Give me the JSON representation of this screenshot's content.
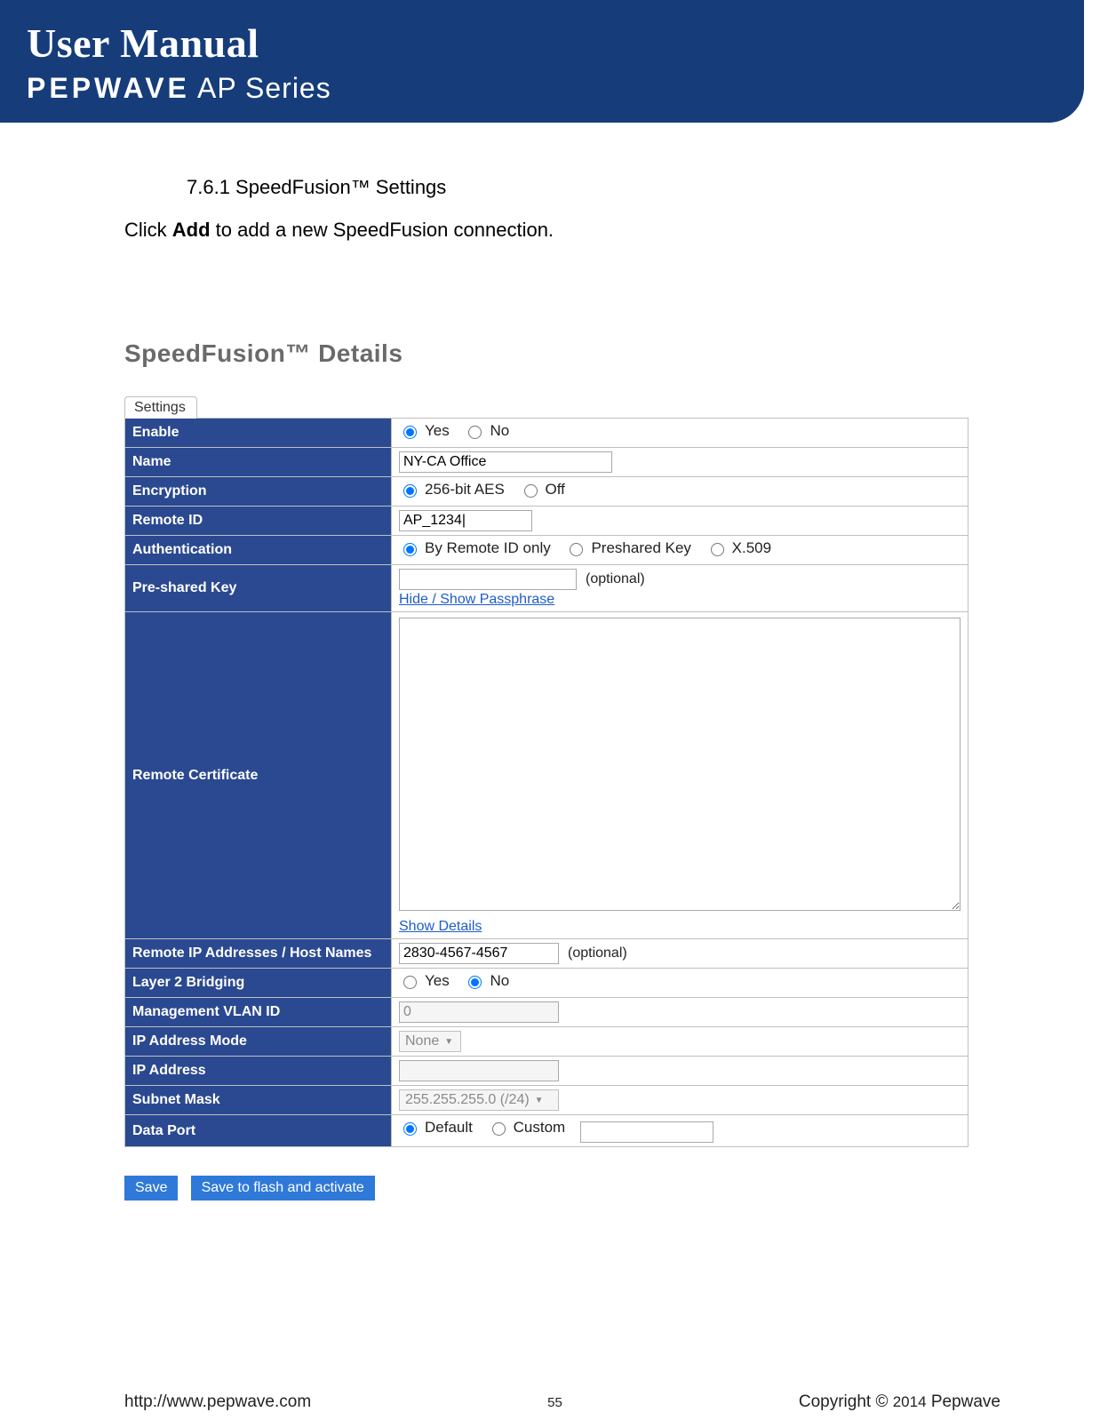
{
  "banner": {
    "title": "User Manual",
    "brand": "PEPWAVE",
    "series": " AP Series"
  },
  "section": {
    "heading": "7.6.1 SpeedFusion™ Settings",
    "instruction_pre": "Click ",
    "instruction_bold": "Add",
    "instruction_post": " to add a new SpeedFusion connection."
  },
  "details": {
    "title": "SpeedFusion™ Details",
    "tab": "Settings"
  },
  "rows": {
    "enable": {
      "label": "Enable",
      "yes": "Yes",
      "no": "No"
    },
    "name": {
      "label": "Name",
      "value": "NY-CA Office"
    },
    "encryption": {
      "label": "Encryption",
      "opt1": "256-bit AES",
      "opt2": "Off"
    },
    "remote_id": {
      "label": "Remote ID",
      "value": "AP_1234|"
    },
    "auth": {
      "label": "Authentication",
      "opt1": "By Remote ID only",
      "opt2": "Preshared Key",
      "opt3": "X.509"
    },
    "psk": {
      "label": "Pre-shared Key",
      "optional": "(optional)",
      "link": "Hide / Show Passphrase"
    },
    "cert": {
      "label": "Remote Certificate",
      "link": "Show Details"
    },
    "remote_ip": {
      "label": "Remote IP Addresses / Host Names",
      "value": "2830-4567-4567",
      "optional": "(optional)"
    },
    "l2": {
      "label": "Layer 2 Bridging",
      "yes": "Yes",
      "no": "No"
    },
    "vlan": {
      "label": "Management VLAN ID",
      "value": "0"
    },
    "ipmode": {
      "label": "IP Address Mode",
      "value": "None"
    },
    "ipaddr": {
      "label": "IP Address"
    },
    "subnet": {
      "label": "Subnet Mask",
      "value": "255.255.255.0 (/24)"
    },
    "dataport": {
      "label": "Data Port",
      "opt1": "Default",
      "opt2": "Custom"
    }
  },
  "buttons": {
    "save": "Save",
    "save_flash": "Save to flash and activate"
  },
  "footer": {
    "url": "http://www.pepwave.com",
    "page": "55",
    "copyright_pre": "Copyright  ©  ",
    "copyright_year": "2014",
    "copyright_post": "  Pepwave"
  }
}
